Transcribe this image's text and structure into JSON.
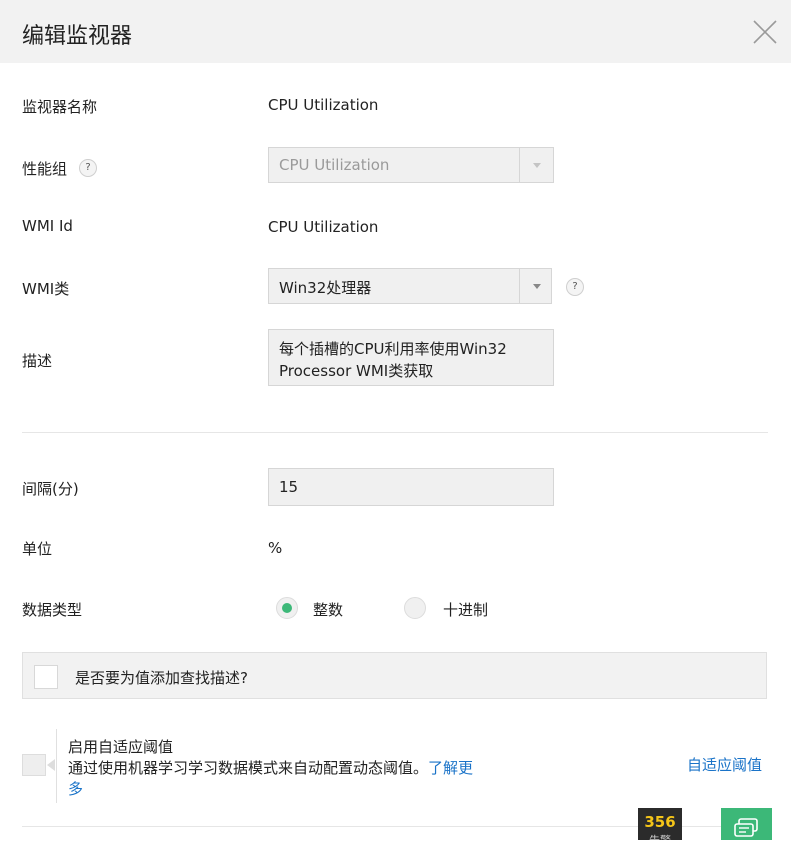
{
  "dialog": {
    "title": "编辑监视器"
  },
  "fields": {
    "monitor_name": {
      "label": "监视器名称",
      "value": "CPU Utilization"
    },
    "performance_group": {
      "label": "性能组",
      "value": "CPU Utilization",
      "help": "?"
    },
    "wmi_id": {
      "label": "WMI Id",
      "value": "CPU Utilization"
    },
    "wmi_class": {
      "label": "WMI类",
      "value": "Win32处理器",
      "help": "?"
    },
    "description": {
      "label": "描述",
      "line1": "每个插槽的CPU利用率使用Win32",
      "line2": "Processor WMI类获取"
    },
    "interval": {
      "label": "间隔(分)",
      "value": "15"
    },
    "unit": {
      "label": "单位",
      "value": "%"
    },
    "data_type": {
      "label": "数据类型",
      "options": [
        {
          "label": "整数",
          "selected": true
        },
        {
          "label": "十进制",
          "selected": false
        }
      ]
    }
  },
  "lookup": {
    "label": "是否要为值添加查找描述?",
    "checked": false
  },
  "adaptive": {
    "title": "启用自适应阈值",
    "desc": "通过使用机器学习学习数据模式来自动配置动态阈值。",
    "learn_more_part1": "了解更",
    "learn_more_part2": "多",
    "right_link": "自适应阈值"
  },
  "badge": {
    "count": "356",
    "label": "告警"
  },
  "colors": {
    "accent": "#3cb878",
    "link": "#1a73c8",
    "header_bg": "#f2f2f2"
  },
  "icons": {
    "close": "close-icon",
    "help": "help-icon",
    "caret": "chevron-down-icon",
    "chat": "chat-icon"
  }
}
